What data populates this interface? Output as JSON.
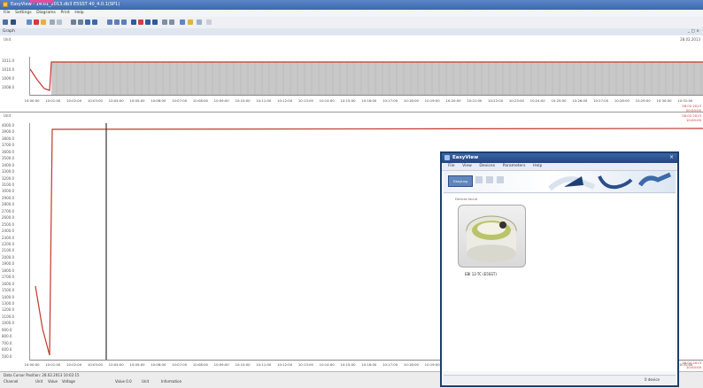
{
  "window": {
    "title": "EasyView - 14:01_2013.db3 E5SST 40_4.0.1(SP1)",
    "menu": [
      "File",
      "Settings",
      "Diagrams",
      "Print",
      "Help"
    ]
  },
  "panel": {
    "title": "Graph",
    "buttons": "_ □ ×"
  },
  "top_chart": {
    "header_left": "Unit",
    "header_right": "28.02.2013",
    "y_labels": [
      "1011.0",
      "1010.0",
      "1009.0",
      "1008.0"
    ],
    "right_labels": [
      "28.02.2013",
      "00:00:00"
    ]
  },
  "bottom_chart": {
    "header_left": "Unit",
    "right_labels_top": [
      "28.02.2013",
      "10:00:00"
    ],
    "y_labels": [
      "4000.0",
      "3900.0",
      "3800.0",
      "3700.0",
      "3600.0",
      "3500.0",
      "3400.0",
      "3300.0",
      "3200.0",
      "3100.0",
      "3000.0",
      "2900.0",
      "2800.0",
      "2700.0",
      "2600.0",
      "2500.0",
      "2400.0",
      "2300.0",
      "2200.0",
      "2100.0",
      "2000.0",
      "1900.0",
      "1800.0",
      "1700.0",
      "1600.0",
      "1500.0",
      "1400.0",
      "1300.0",
      "1200.0",
      "1100.0",
      "1000.0",
      "900.0",
      "800.0",
      "700.0",
      "600.0",
      "500.0"
    ],
    "right_labels_bottom": [
      "28.02.2013",
      "10:00:00"
    ]
  },
  "x_labels": [
    "10:00:00",
    "10:01:00",
    "10:02:00",
    "10:03:00",
    "10:04:00",
    "10:05:00",
    "10:06:00",
    "10:07:00",
    "10:08:00",
    "10:09:00",
    "10:10:00",
    "10:11:00",
    "10:12:00",
    "10:13:00",
    "10:14:00",
    "10:15:00",
    "10:16:00",
    "10:17:00",
    "10:18:00",
    "10:19:00",
    "10:20:00",
    "10:21:00",
    "10:22:00",
    "10:23:00",
    "10:24:00",
    "10:25:00",
    "10:26:00",
    "10:27:00",
    "10:28:00",
    "10:29:00",
    "10:30:00",
    "10:31:00"
  ],
  "status": {
    "cursor": "Data Cursor Position: 28.02.2013 10:02:15",
    "items": [
      "Channel",
      "Unit",
      "Value",
      "Voltage",
      "Value 0.0",
      "Unit",
      "Information"
    ]
  },
  "dialog": {
    "title": "EasyView",
    "menu": [
      "File",
      "View",
      "Devices",
      "Parameters",
      "Help"
    ],
    "device_button": "EasyLog",
    "group_label": "Devices found",
    "device_name": "EBI 12-TC (E5SST)",
    "status": "0 device"
  },
  "colors": {
    "titlebar": "#3d68ad",
    "plot_red": "#c0392b",
    "top_band": "#c8c8c8",
    "dialog_border": "#1f3e6e"
  }
}
